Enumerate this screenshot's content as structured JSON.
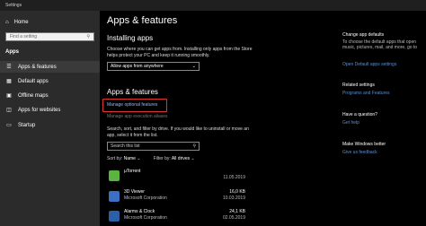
{
  "window": {
    "title": "Settings"
  },
  "sidebar": {
    "home_label": "Home",
    "search_placeholder": "Find a setting",
    "section": "Apps",
    "items": [
      {
        "label": "Apps & features",
        "icon": "list-icon"
      },
      {
        "label": "Default apps",
        "icon": "default-apps-icon"
      },
      {
        "label": "Offline maps",
        "icon": "map-icon"
      },
      {
        "label": "Apps for websites",
        "icon": "web-icon"
      },
      {
        "label": "Startup",
        "icon": "startup-icon"
      }
    ]
  },
  "main": {
    "title": "Apps & features",
    "installing": {
      "heading": "Installing apps",
      "description": "Choose where you can get apps from. Installing only apps from the Store helps protect your PC and keep it running smoothly.",
      "dropdown_value": "Allow apps from anywhere"
    },
    "apps": {
      "heading": "Apps & features",
      "manage_optional_link": "Manage optional features",
      "manage_aliases_link": "Manage app execution aliases",
      "description": "Search, sort, and filter by drive. If you would like to uninstall or move an app, select it from the list.",
      "search_placeholder": "Search this list",
      "sort_label": "Sort by:",
      "sort_value": "Name",
      "filter_label": "Filter by:",
      "filter_value": "All drives",
      "list": [
        {
          "name": "µTorrent",
          "publisher": "",
          "size": "",
          "date": "11.05.2019",
          "color": "#5ab53c"
        },
        {
          "name": "3D Viewer",
          "publisher": "Microsoft Corporation",
          "size": "16,0 KB",
          "date": "10.03.2019",
          "color": "#3a6fc4"
        },
        {
          "name": "Alarms & Clock",
          "publisher": "Microsoft Corporation",
          "size": "24,1 KB",
          "date": "02.05.2019",
          "color": "#2b5fa8"
        }
      ]
    }
  },
  "right": {
    "defaults_heading": "Change app defaults",
    "defaults_text": "To choose the default apps that open music, pictures, mail, and more, go to",
    "defaults_link": "Open Default apps settings",
    "related_heading": "Related settings",
    "related_link": "Programs and Features",
    "question_heading": "Have a question?",
    "question_link": "Get help",
    "better_heading": "Make Windows better",
    "better_link": "Give us feedback"
  }
}
